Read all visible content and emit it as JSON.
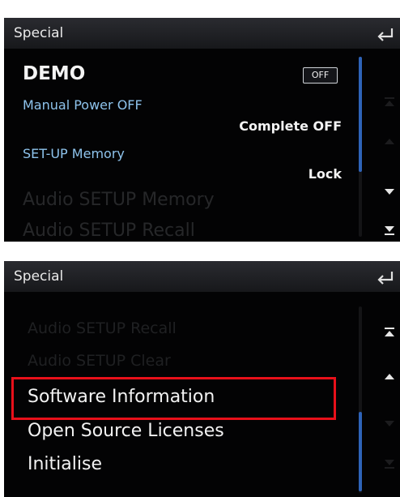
{
  "top_screen": {
    "header_title": "Special",
    "items": [
      {
        "label": "DEMO",
        "toggle": "OFF"
      },
      {
        "label": "Manual Power OFF",
        "value": "Complete OFF"
      },
      {
        "label": "SET-UP Memory",
        "value": "Lock"
      },
      {
        "label": "Audio SETUP Memory"
      },
      {
        "label": "Audio SETUP Recall"
      }
    ]
  },
  "bottom_screen": {
    "header_title": "Special",
    "items": [
      {
        "label": "Audio SETUP Recall"
      },
      {
        "label": "Audio SETUP Clear"
      },
      {
        "label": "Software Information"
      },
      {
        "label": "Open Source Licenses"
      },
      {
        "label": "Initialise"
      }
    ],
    "highlighted_item": "Software Information"
  },
  "icons": {
    "back": "back-arrow-icon",
    "top": "jump-top-icon",
    "up": "scroll-up-icon",
    "down": "scroll-down-icon",
    "bottom": "jump-bottom-icon"
  },
  "colors": {
    "background": "#030304",
    "header": "#1f2024",
    "blue_label": "#8ec3ec",
    "scrollbar": "#2e63b8",
    "highlight": "#e8101a"
  }
}
